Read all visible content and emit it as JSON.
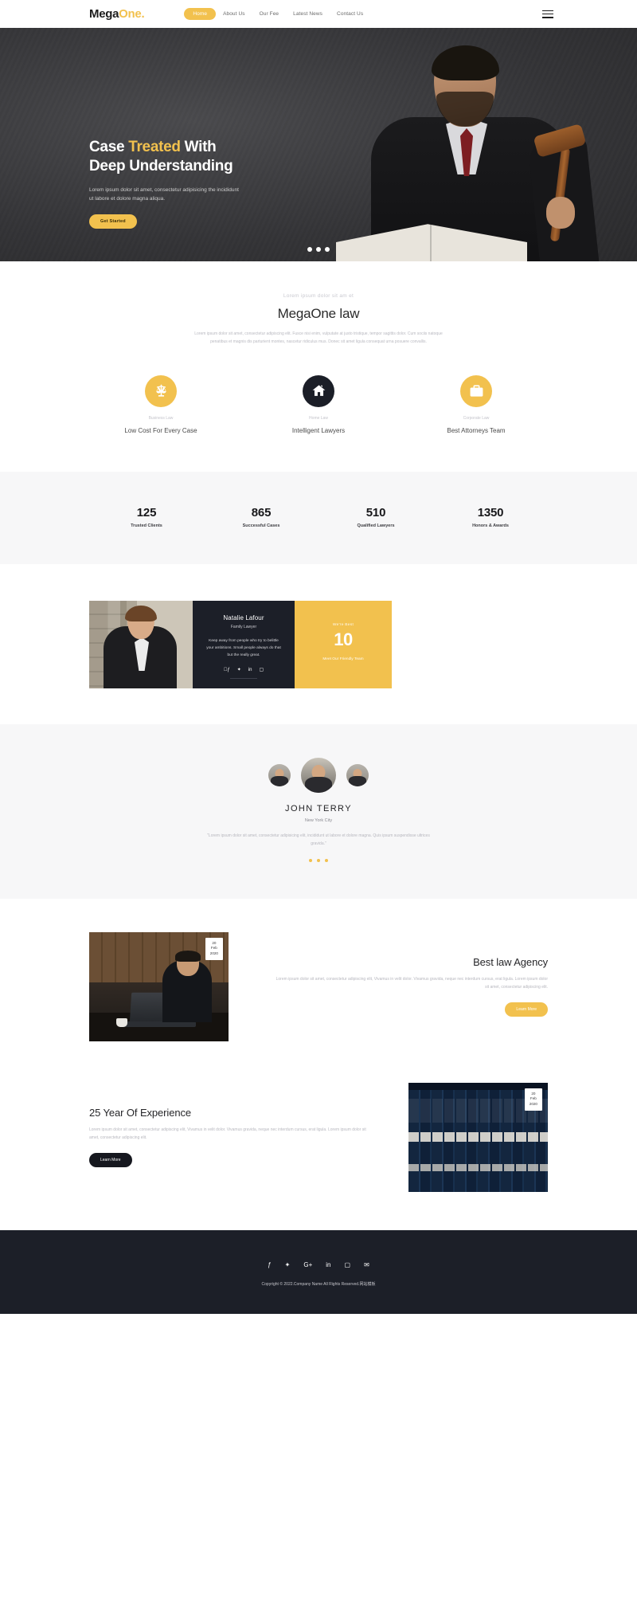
{
  "nav": {
    "logo_main": "Mega",
    "logo_accent": "One",
    "logo_dot": ".",
    "links": [
      {
        "label": "Home",
        "active": true
      },
      {
        "label": "About Us",
        "active": false
      },
      {
        "label": "Our Fee",
        "active": false
      },
      {
        "label": "Latest News",
        "active": false
      },
      {
        "label": "Contact Us",
        "active": false
      }
    ],
    "menu_icon": "hamburger-icon"
  },
  "hero": {
    "title_part1": "Case ",
    "title_highlight": "Treated",
    "title_part2": " With",
    "title_line2": "Deep Understanding",
    "subtitle": "Lorem ipsum dolor sit amet, consectetur adipisicing the incididunt ut labore et dolore magna aliqua.",
    "cta": "Get Started",
    "slider_dots": 3
  },
  "about": {
    "eyebrow": "Lorem ipsum dolor sit am et",
    "title": "MegaOne law",
    "description": "Lorem ipsum dolor sit amet, consectetur adipiscing elit. Fusce nisi enim, vulputate at justo tristique, tempor sagittis dolor. Cum sociis natoque penatibus et magnis dis parturient montes, nascetur ridiculus mus. Donec sit amet ligula consequat urna posuere convallis.",
    "services": [
      {
        "icon": "scales-icon",
        "style": "yellow",
        "tag": "Business Law",
        "name": "Low Cost For Every Case"
      },
      {
        "icon": "home-icon",
        "style": "dark",
        "tag": "Home Law",
        "name": "Intelligent Lawyers"
      },
      {
        "icon": "briefcase-icon",
        "style": "yellow",
        "tag": "Corporate Law",
        "name": "Best Attorneys Team"
      }
    ]
  },
  "stats": [
    {
      "number": "125",
      "label": "Trusted Clients"
    },
    {
      "number": "865",
      "label": "Successful Cases"
    },
    {
      "number": "510",
      "label": "Qualified Lawyers"
    },
    {
      "number": "1350",
      "label": "Honors & Awards"
    }
  ],
  "team": {
    "photo_alt": "female-lawyer-photo",
    "card": {
      "name": "Natalie Lafour",
      "role": "Family Lawyer",
      "quote": "Keep away from people who try to belittle your ambitions. Small people always do that but the really great.",
      "socials": [
        "facebook-icon",
        "twitter-icon",
        "linkedin-icon",
        "instagram-icon"
      ]
    },
    "stat": {
      "top": "We're Best",
      "number": "10",
      "bottom": "Meet Our Friendly Team"
    }
  },
  "testimonial": {
    "avatars": [
      "avatar-left",
      "avatar-center",
      "avatar-right"
    ],
    "name": "JOHN TERRY",
    "city": "New York City",
    "text": "\"Lorem ipsum dolor sit amet, consectetur adipisicing elit, incididunt ut labore et dolore magna. Quis ipsum suspendisse ultrices gravida.\"",
    "dots": 3
  },
  "news": [
    {
      "date_day": "20",
      "date_month": "Feb",
      "date_year": "2020",
      "title": "Best law Agency",
      "text": "Lorem ipsum dolor sit amet, consectetur adipiscing elit, Vivamus in velit dolor. Vivamus gravida, neque nec interdum cursus, erat ligula. Lorem ipsum dolor sit amet, consectetur adipiscing elit.",
      "button": "Learn More",
      "image": "businessman-laptop-photo"
    },
    {
      "date_day": "20",
      "date_month": "Feb",
      "date_year": "2020",
      "title": "25 Year Of Experience",
      "text": "Lorem ipsum dolor sit amet, consectetur adipiscing elit, Vivamus in velit dolor. Vivamus gravida, neque nec interdum cursus, erat ligula. Lorem ipsum dolor sit amet, consectetur adipiscing elit.",
      "button": "Learn More",
      "image": "law-books-shelf-photo"
    }
  ],
  "footer": {
    "socials": [
      "facebook-icon",
      "twitter-icon",
      "google-plus-icon",
      "linkedin-icon",
      "instagram-icon",
      "envelope-icon"
    ],
    "copyright": "Copyright © 2022.Company Name All Rights Reserved.网站模板"
  },
  "colors": {
    "accent": "#f2c14e",
    "dark": "#1c1f28",
    "muted": "#b7b7be",
    "light_bg": "#f7f7f8"
  }
}
